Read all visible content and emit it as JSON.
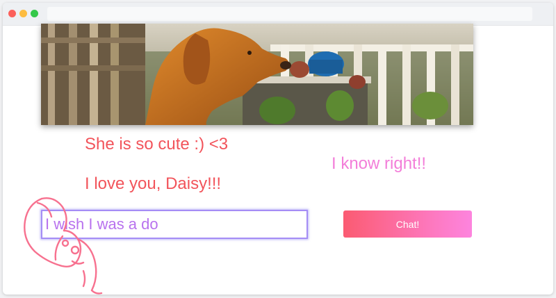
{
  "window": {
    "controls": [
      "close",
      "minimize",
      "maximize"
    ]
  },
  "photo": {
    "subject": "dog-photo"
  },
  "messages": [
    {
      "side": "left",
      "text": "She is so cute :) <3"
    },
    {
      "side": "right",
      "text": "I know right!!"
    },
    {
      "side": "left",
      "text": "I love you, Daisy!!!"
    }
  ],
  "chat_input": {
    "value": "I wish I was a do"
  },
  "chat_button": {
    "label": "Chat!"
  },
  "colors": {
    "message_left": "#f2545b",
    "message_right": "#f37ed9",
    "input_border": "#a58df5",
    "button_gradient_start": "#fb5b72",
    "button_gradient_end": "#fd84de",
    "doodle_stroke": "#f7718f"
  },
  "icons": [
    "dog-doodle-icon"
  ]
}
